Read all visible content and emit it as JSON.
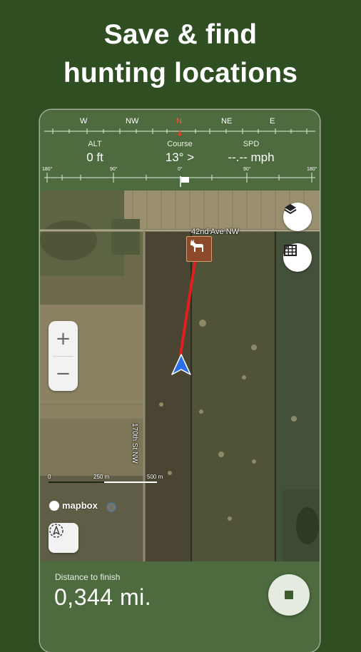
{
  "headline": {
    "line1": "Save & find",
    "line2": "hunting locations"
  },
  "compass": {
    "directions": [
      "W",
      "NW",
      "N",
      "NE",
      "E"
    ],
    "heading_markers": [
      "180°",
      "90°",
      "0°",
      "90°",
      "180°"
    ],
    "alt": {
      "label": "ALT",
      "value": "0 ft"
    },
    "course": {
      "label": "Course",
      "value": "13° >"
    },
    "spd": {
      "label": "SPD",
      "value": "--.-- mph"
    }
  },
  "map": {
    "roads": [
      "42nd Ave NW",
      "170th St NW"
    ],
    "scale": [
      "0",
      "250 m",
      "500 m"
    ],
    "attribution": "mapbox",
    "info_symbol": "i"
  },
  "controls": {
    "zoom_in": "+",
    "zoom_out": "−"
  },
  "icons": {
    "layers": "layers-icon",
    "grid": "grid-icon",
    "deer_marker": "deer-icon",
    "location_arrow": "navigation-arrow-icon",
    "recenter": "compass-recenter-icon",
    "flag": "flag-icon",
    "stop": "stop-icon"
  },
  "colors": {
    "background": "#2f4f23",
    "panel": "#4d6b3f",
    "route": "#e11f1f",
    "marker": "#8c4a2b",
    "arrow": "#2a6ee8",
    "north": "#e0402c"
  },
  "tracking": {
    "distance_label": "Distance to finish",
    "distance_value": "0,344 mi."
  }
}
